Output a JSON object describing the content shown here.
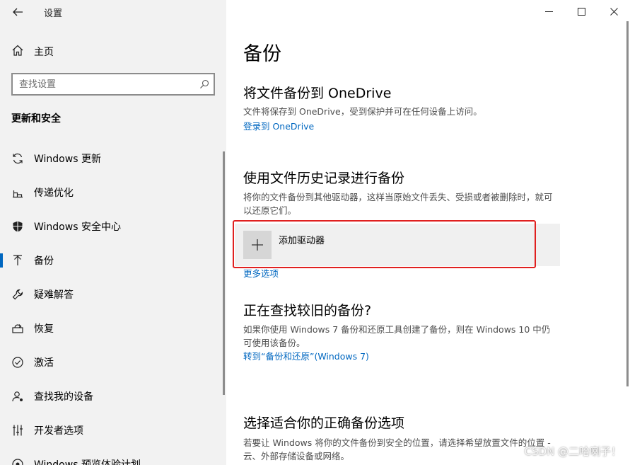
{
  "window": {
    "title": "设置"
  },
  "sidebar": {
    "home_label": "主页",
    "search_placeholder": "查找设置",
    "section_heading": "更新和安全",
    "items": [
      {
        "label": "Windows 更新",
        "icon": "sync-icon"
      },
      {
        "label": "传递优化",
        "icon": "delivery-icon"
      },
      {
        "label": "Windows 安全中心",
        "icon": "shield-icon"
      },
      {
        "label": "备份",
        "icon": "backup-arrow-icon",
        "active": true
      },
      {
        "label": "疑难解答",
        "icon": "wrench-icon"
      },
      {
        "label": "恢复",
        "icon": "recovery-icon"
      },
      {
        "label": "激活",
        "icon": "check-circle-icon"
      },
      {
        "label": "查找我的设备",
        "icon": "person-pin-icon"
      },
      {
        "label": "开发者选项",
        "icon": "developer-icon"
      },
      {
        "label": "Windows 预览体验计划",
        "icon": "insider-icon"
      }
    ]
  },
  "main": {
    "title": "备份",
    "onedrive": {
      "heading": "将文件备份到 OneDrive",
      "desc": "文件将保存到 OneDrive，受到保护并可在任何设备上访问。",
      "link": "登录到 OneDrive"
    },
    "history": {
      "heading": "使用文件历史记录进行备份",
      "desc": "将你的文件备份到其他驱动器，这样当原始文件丢失、受损或者被删除时，就可以还原它们。",
      "add_drive_label": "添加驱动器",
      "more_options": "更多选项"
    },
    "older": {
      "heading": "正在查找较旧的备份?",
      "desc": "如果你使用 Windows 7 备份和还原工具创建了备份，则在 Windows 10 中仍可使用该备份。",
      "link": "转到“备份和还原”(Windows 7)"
    },
    "choose": {
      "heading": "选择适合你的正确备份选项",
      "desc": "若要让 Windows 将你的文件备份到安全的位置，请选择希望放置文件的位置 - 云、外部存储设备或网络。"
    }
  },
  "watermark": "CSDN @二哈喇子！",
  "colors": {
    "accent": "#0067c0",
    "highlight": "#e0201f",
    "sidebar_bg": "#f2f2f2"
  }
}
